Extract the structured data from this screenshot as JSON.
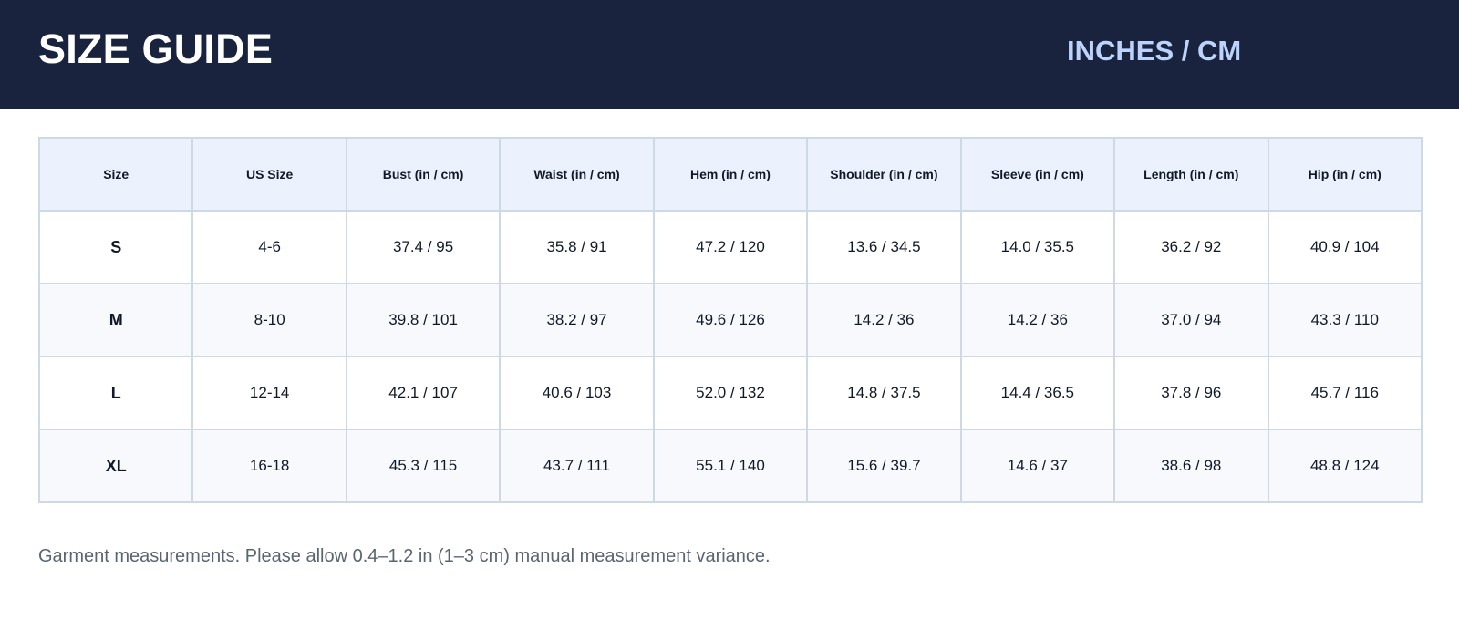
{
  "header": {
    "title": "SIZE GUIDE",
    "units": "INCHES / CM",
    "background": "#19233e",
    "units_color": "#bcd4fb"
  },
  "table": {
    "columns": [
      "Size",
      "US Size",
      "Bust (in / cm)",
      "Waist (in / cm)",
      "Hem (in / cm)",
      "Shoulder (in / cm)",
      "Sleeve (in / cm)",
      "Length (in / cm)",
      "Hip (in / cm)"
    ],
    "rows": [
      [
        "S",
        "4-6",
        "37.4 / 95",
        "35.8 / 91",
        "47.2 / 120",
        "13.6 / 34.5",
        "14.0 / 35.5",
        "36.2 / 92",
        "40.9 / 104"
      ],
      [
        "M",
        "8-10",
        "39.8 / 101",
        "38.2 / 97",
        "49.6 / 126",
        "14.2 / 36",
        "14.2 / 36",
        "37.0 / 94",
        "43.3 / 110"
      ],
      [
        "L",
        "12-14",
        "42.1 / 107",
        "40.6 / 103",
        "52.0 / 132",
        "14.8 / 37.5",
        "14.4 / 36.5",
        "37.8 / 96",
        "45.7 / 116"
      ],
      [
        "XL",
        "16-18",
        "45.3 / 115",
        "43.7 / 111",
        "55.1 / 140",
        "15.6 / 39.7",
        "14.6 / 37",
        "38.6 / 98",
        "48.8 / 124"
      ]
    ]
  },
  "footnote": "Garment measurements. Please allow 0.4–1.2 in (1–3 cm) manual measurement variance."
}
